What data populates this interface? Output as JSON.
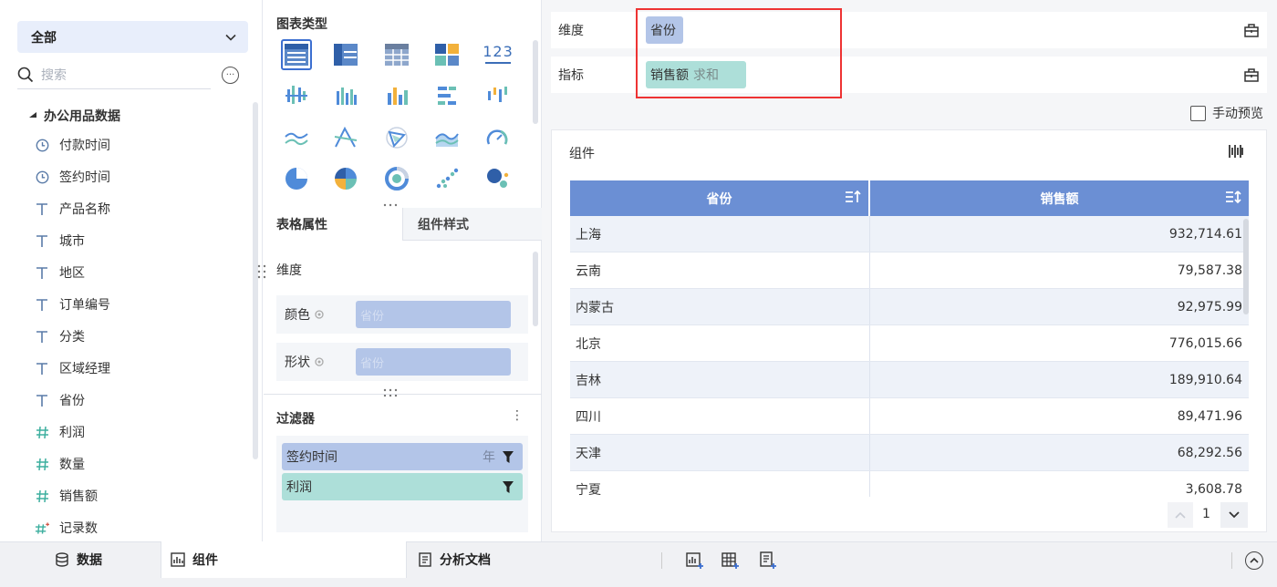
{
  "left": {
    "datasource": "全部",
    "search_placeholder": "搜索",
    "more": "···",
    "tree_root": "办公用品数据",
    "fields": [
      {
        "label": "付款时间",
        "type": "time"
      },
      {
        "label": "签约时间",
        "type": "time"
      },
      {
        "label": "产品名称",
        "type": "text"
      },
      {
        "label": "城市",
        "type": "text"
      },
      {
        "label": "地区",
        "type": "text"
      },
      {
        "label": "订单编号",
        "type": "text"
      },
      {
        "label": "分类",
        "type": "text"
      },
      {
        "label": "区域经理",
        "type": "text"
      },
      {
        "label": "省份",
        "type": "text"
      },
      {
        "label": "利润",
        "type": "number"
      },
      {
        "label": "数量",
        "type": "number"
      },
      {
        "label": "销售额",
        "type": "number"
      },
      {
        "label": "记录数",
        "type": "number-calc"
      }
    ]
  },
  "middle": {
    "chart_type_title": "图表类型",
    "tabs": {
      "table_props": "表格属性",
      "component_style": "组件样式"
    },
    "dimension_label": "维度",
    "color_label": "颜色",
    "color_placeholder": "省份",
    "shape_label": "形状",
    "shape_placeholder": "省份",
    "chart_icon_123": "123",
    "filter_title": "过滤器",
    "filter_more": "⋮",
    "filters": [
      {
        "label": "签约时间",
        "suffix": "年"
      },
      {
        "label": "利润",
        "suffix": ""
      }
    ]
  },
  "right": {
    "dim_label": "维度",
    "dim_pill": "省份",
    "metric_label": "指标",
    "metric_pill": "销售额",
    "metric_agg": "求和",
    "manual_preview": "手动预览",
    "component_title": "组件",
    "table": {
      "headers": [
        "省份",
        "销售额"
      ],
      "rows": [
        [
          "上海",
          "932,714.61"
        ],
        [
          "云南",
          "79,587.38"
        ],
        [
          "内蒙古",
          "92,975.99"
        ],
        [
          "北京",
          "776,015.66"
        ],
        [
          "吉林",
          "189,910.64"
        ],
        [
          "四川",
          "89,471.96"
        ],
        [
          "天津",
          "68,292.56"
        ],
        [
          "宁夏",
          "3,608.78"
        ]
      ]
    },
    "page_number": "1"
  },
  "bottom": {
    "tab_data": "数据",
    "tab_component": "组件",
    "tab_doc": "分析文档"
  },
  "colors": {
    "accent": "#3c6fd0",
    "dim_pill": "#b3c5e8",
    "metric_pill": "#addfd9",
    "table_header": "#6b8fd4",
    "highlight": "#ee3333"
  }
}
